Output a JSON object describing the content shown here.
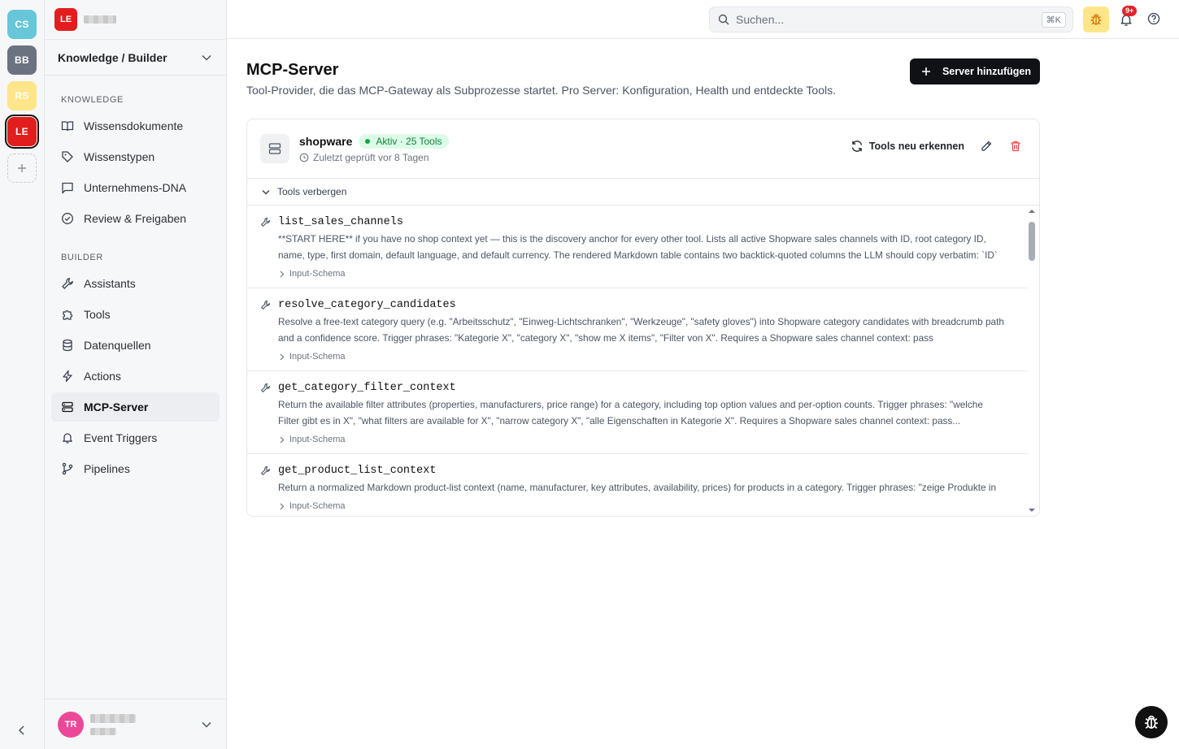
{
  "workspaces": [
    {
      "initials": "CS",
      "color": "#67c7d8"
    },
    {
      "initials": "BB",
      "color": "#6b7280"
    },
    {
      "initials": "RS",
      "color": "#fde68a"
    },
    {
      "initials": "LE",
      "color": "#e11d1d",
      "active": true
    }
  ],
  "sidebar": {
    "org_logo": "LE",
    "switcher_label": "Knowledge / Builder",
    "sections": [
      {
        "title": "KNOWLEDGE",
        "items": [
          {
            "label": "Wissensdokumente",
            "icon": "book-open-icon"
          },
          {
            "label": "Wissenstypen",
            "icon": "tag-icon"
          },
          {
            "label": "Unternehmens-DNA",
            "icon": "message-square-icon"
          },
          {
            "label": "Review & Freigaben",
            "icon": "check-circle-icon"
          }
        ]
      },
      {
        "title": "BUILDER",
        "items": [
          {
            "label": "Assistants",
            "icon": "wrench-icon"
          },
          {
            "label": "Tools",
            "icon": "puzzle-icon"
          },
          {
            "label": "Datenquellen",
            "icon": "database-icon"
          },
          {
            "label": "Actions",
            "icon": "lightning-icon"
          },
          {
            "label": "MCP-Server",
            "icon": "server-icon",
            "active": true
          },
          {
            "label": "Event Triggers",
            "icon": "bell-icon"
          },
          {
            "label": "Pipelines",
            "icon": "git-branch-icon"
          }
        ]
      }
    ],
    "user_initials": "TR"
  },
  "topbar": {
    "search_placeholder": "Suchen...",
    "search_shortcut": "⌘K",
    "notification_count": "9+"
  },
  "page": {
    "title": "MCP-Server",
    "subtitle": "Tool-Provider, die das MCP-Gateway als Subprozesse startet. Pro Server: Konfiguration, Health und entdeckte Tools.",
    "add_button_label": "Server hinzufügen"
  },
  "server": {
    "name": "shopware",
    "status_badge": "Aktiv · 25 Tools",
    "last_checked": "Zuletzt geprüft vor 8 Tagen",
    "rescan_label": "Tools neu erkennen",
    "toggle_tools_label": "Tools verbergen",
    "tools": [
      {
        "name": "list_sales_channels",
        "description": "**START HERE** if you have no shop context yet — this is the discovery anchor for every other tool. Lists all active Shopware sales channels with ID, root category ID, name, type, first domain, default language, and default currency. The rendered Markdown table contains two backtick-quoted columns the LLM should copy verbatim: `ID` → us...",
        "schema_label": "Input-Schema"
      },
      {
        "name": "resolve_category_candidates",
        "description": "Resolve a free-text category query (e.g. \"Arbeitsschutz\", \"Einweg-Lichtschranken\", \"Werkzeuge\", \"safety gloves\") into Shopware category candidates with breadcrumb path and a confidence score. Trigger phrases: \"Kategorie X\", \"category X\", \"show me X items\", \"Filter von X\". Requires a Shopware sales channel context: pass `salesChannelId`...",
        "schema_label": "Input-Schema"
      },
      {
        "name": "get_category_filter_context",
        "description": "Return the available filter attributes (properties, manufacturers, price range) for a category, including top option values and per-option counts. Trigger phrases: \"welche Filter gibt es in X\", \"what filters are available for X\", \"narrow category X\", \"alle Eigenschaften in Kategorie X\". Requires a Shopware sales channel context: pass...",
        "schema_label": "Input-Schema"
      },
      {
        "name": "get_product_list_context",
        "description": "Return a normalized Markdown product-list context (name, manufacturer, key attributes, availability, prices) for products in a category. Trigger phrases: \"zeige Produkte in",
        "schema_label": "Input-Schema"
      }
    ]
  },
  "colors": {
    "primary_button": "#0f1115",
    "status_green": "#15803d",
    "danger": "#ef4444",
    "bug_button": "#fde68a"
  }
}
